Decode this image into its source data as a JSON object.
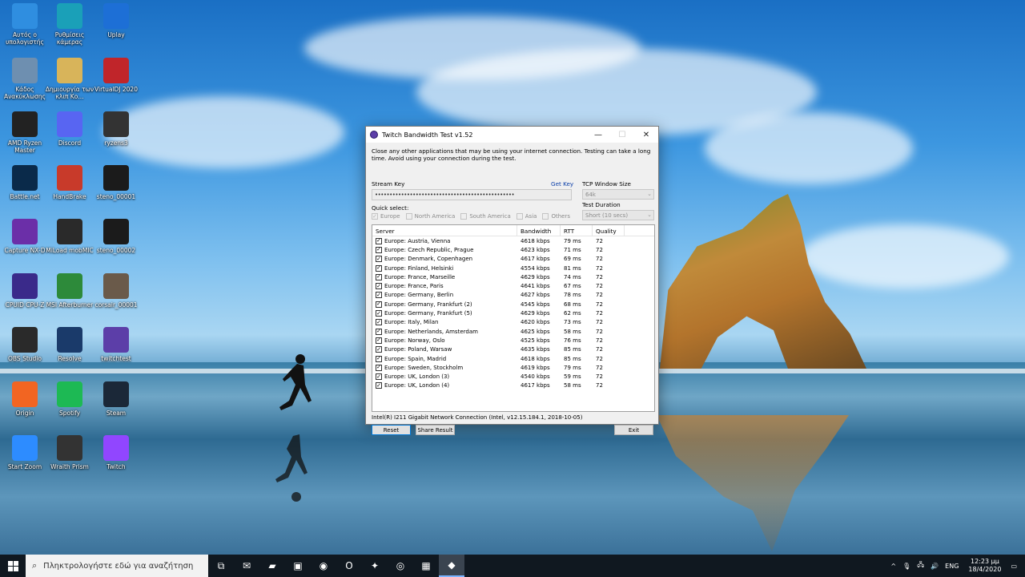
{
  "desktop": {
    "icons": [
      {
        "label": "Αυτός ο υπολογιστής",
        "icon": "computer-icon",
        "color": "#2f8ee0"
      },
      {
        "label": "Ρυθμίσεις κάμερας",
        "icon": "camera-settings-icon",
        "color": "#1aa0b8"
      },
      {
        "label": "Uplay",
        "icon": "uplay-icon",
        "color": "#1d6fd6"
      },
      {
        "label": "Κάδος Ανακύκλωσης",
        "icon": "recycle-bin-icon",
        "color": "#6e8fb0"
      },
      {
        "label": "Δημιουργία των κλιπ Κο...",
        "icon": "folder-icon",
        "color": "#d8b45a"
      },
      {
        "label": "VirtualDJ 2020",
        "icon": "virtualdj-icon",
        "color": "#c0252a"
      },
      {
        "label": "AMD Ryzen Master",
        "icon": "ryzen-master-icon",
        "color": "#222222"
      },
      {
        "label": "Discord",
        "icon": "discord-icon",
        "color": "#5865f2"
      },
      {
        "label": "ryzens3",
        "icon": "image-file-icon",
        "color": "#333333"
      },
      {
        "label": "Battle.net",
        "icon": "battlenet-icon",
        "color": "#0a2a4a"
      },
      {
        "label": "HandBrake",
        "icon": "handbrake-icon",
        "color": "#c83a2a"
      },
      {
        "label": "steno_00001",
        "icon": "image-file-icon",
        "color": "#1b1b1b"
      },
      {
        "label": "Capture NX-D",
        "icon": "capture-nxd-icon",
        "color": "#6b2fa8"
      },
      {
        "label": "MiLoad mobMIC",
        "icon": "app-icon",
        "color": "#2a2a2a"
      },
      {
        "label": "steno_00002",
        "icon": "image-file-icon",
        "color": "#1b1b1b"
      },
      {
        "label": "CPUID CPU-Z",
        "icon": "cpuz-icon",
        "color": "#3a2a8a"
      },
      {
        "label": "MSI Afterburner",
        "icon": "afterburner-icon",
        "color": "#2d8a3a"
      },
      {
        "label": "corsair_00001",
        "icon": "image-file-icon",
        "color": "#6a5a4a"
      },
      {
        "label": "OBS Studio",
        "icon": "obs-icon",
        "color": "#2a2a2a"
      },
      {
        "label": "Resolve",
        "icon": "resolve-icon",
        "color": "#1a3a6a"
      },
      {
        "label": "twitchtest",
        "icon": "twitchtest-icon",
        "color": "#5c3ea8"
      },
      {
        "label": "Origin",
        "icon": "origin-icon",
        "color": "#f26522"
      },
      {
        "label": "Spotify",
        "icon": "spotify-icon",
        "color": "#1db954"
      },
      {
        "label": "Steam",
        "icon": "steam-icon",
        "color": "#1b2838"
      },
      {
        "label": "Start Zoom",
        "icon": "zoom-icon",
        "color": "#2d8cff"
      },
      {
        "label": "Wraith Prism",
        "icon": "coolermaster-icon",
        "color": "#333333"
      },
      {
        "label": "Twitch",
        "icon": "twitch-icon",
        "color": "#9146ff"
      }
    ]
  },
  "window": {
    "title": "Twitch Bandwidth Test v1.52",
    "minimize": "—",
    "maximize": "☐",
    "close": "✕",
    "note": "Close any other applications that may be using your internet connection. Testing can take a long time. Avoid using your connection during the test.",
    "stream_key_label": "Stream Key",
    "stream_key_value": "••••••••••••••••••••••••••••••••••••••••••••••••",
    "get_key": "Get Key",
    "tcp_label": "TCP Window Size",
    "tcp_value": "64k",
    "duration_label": "Test Duration",
    "duration_value": "Short (10 secs)",
    "quick_select_label": "Quick select:",
    "regions": [
      {
        "name": "Europe",
        "checked": true
      },
      {
        "name": "North America",
        "checked": false
      },
      {
        "name": "South America",
        "checked": false
      },
      {
        "name": "Asia",
        "checked": false
      },
      {
        "name": "Others",
        "checked": false
      }
    ],
    "columns": {
      "server": "Server",
      "bandwidth": "Bandwidth",
      "rtt": "RTT",
      "quality": "Quality"
    },
    "rows": [
      {
        "server": "Europe: Austria, Vienna",
        "bandwidth": "4618 kbps",
        "rtt": "79 ms",
        "quality": "72"
      },
      {
        "server": "Europe: Czech Republic, Prague",
        "bandwidth": "4623 kbps",
        "rtt": "71 ms",
        "quality": "72"
      },
      {
        "server": "Europe: Denmark, Copenhagen",
        "bandwidth": "4617 kbps",
        "rtt": "69 ms",
        "quality": "72"
      },
      {
        "server": "Europe: Finland, Helsinki",
        "bandwidth": "4554 kbps",
        "rtt": "81 ms",
        "quality": "72"
      },
      {
        "server": "Europe: France, Marseille",
        "bandwidth": "4629 kbps",
        "rtt": "74 ms",
        "quality": "72"
      },
      {
        "server": "Europe: France, Paris",
        "bandwidth": "4641 kbps",
        "rtt": "67 ms",
        "quality": "72"
      },
      {
        "server": "Europe: Germany, Berlin",
        "bandwidth": "4627 kbps",
        "rtt": "78 ms",
        "quality": "72"
      },
      {
        "server": "Europe: Germany, Frankfurt (2)",
        "bandwidth": "4545 kbps",
        "rtt": "68 ms",
        "quality": "72"
      },
      {
        "server": "Europe: Germany, Frankfurt (5)",
        "bandwidth": "4629 kbps",
        "rtt": "62 ms",
        "quality": "72"
      },
      {
        "server": "Europe: Italy, Milan",
        "bandwidth": "4620 kbps",
        "rtt": "73 ms",
        "quality": "72"
      },
      {
        "server": "Europe: Netherlands, Amsterdam",
        "bandwidth": "4625 kbps",
        "rtt": "58 ms",
        "quality": "72"
      },
      {
        "server": "Europe: Norway, Oslo",
        "bandwidth": "4525 kbps",
        "rtt": "76 ms",
        "quality": "72"
      },
      {
        "server": "Europe: Poland, Warsaw",
        "bandwidth": "4635 kbps",
        "rtt": "85 ms",
        "quality": "72"
      },
      {
        "server": "Europe: Spain, Madrid",
        "bandwidth": "4618 kbps",
        "rtt": "85 ms",
        "quality": "72"
      },
      {
        "server": "Europe: Sweden, Stockholm",
        "bandwidth": "4619 kbps",
        "rtt": "79 ms",
        "quality": "72"
      },
      {
        "server": "Europe: UK, London (3)",
        "bandwidth": "4540 kbps",
        "rtt": "59 ms",
        "quality": "72"
      },
      {
        "server": "Europe: UK, London (4)",
        "bandwidth": "4617 kbps",
        "rtt": "58 ms",
        "quality": "72"
      }
    ],
    "nic": "Intel(R) I211 Gigabit Network Connection (Intel, v12.15.184.1, 2018-10-05)",
    "reset": "Reset",
    "share": "Share Result",
    "exit": "Exit"
  },
  "taskbar": {
    "search_placeholder": "Πληκτρολογήστε εδώ για αναζήτηση",
    "items": [
      {
        "icon": "task-view-icon",
        "glyph": "⧉"
      },
      {
        "icon": "mail-icon",
        "glyph": "✉"
      },
      {
        "icon": "file-explorer-icon",
        "glyph": "▰"
      },
      {
        "icon": "store-icon",
        "glyph": "▣"
      },
      {
        "icon": "chrome-icon",
        "glyph": "◉"
      },
      {
        "icon": "opera-icon",
        "glyph": "O"
      },
      {
        "icon": "battlenet-icon",
        "glyph": "✦"
      },
      {
        "icon": "obs-icon",
        "glyph": "◎"
      },
      {
        "icon": "app-icon",
        "glyph": "▦"
      },
      {
        "icon": "twitchtest-icon",
        "glyph": "◆"
      }
    ],
    "tray": {
      "chevron": "^",
      "mic": "🎙",
      "network": "🖧",
      "volume": "🔊",
      "language": "ENG",
      "time": "12:23 μμ",
      "date": "18/4/2020",
      "notifications": "▭"
    }
  }
}
